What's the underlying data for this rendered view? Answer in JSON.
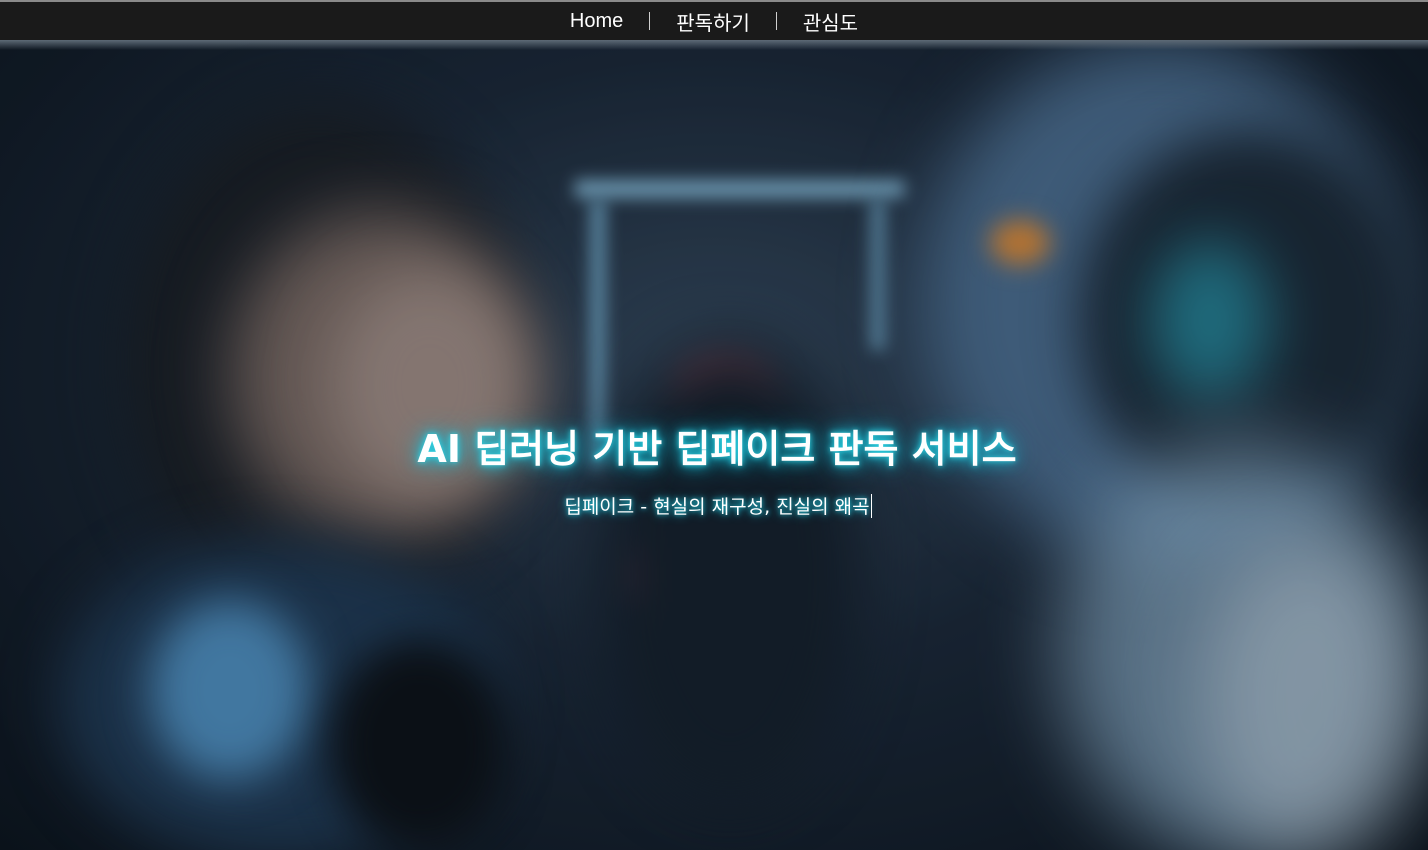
{
  "nav": {
    "items": [
      {
        "label": "Home"
      },
      {
        "label": "판독하기"
      },
      {
        "label": "관심도"
      }
    ]
  },
  "hero": {
    "title": "AI 딥러닝 기반 딥페이크 판독 서비스",
    "subtitle": "딥페이크 - 현실의 재구성, 진실의 왜곡",
    "background_description_colors": {
      "glow": "#19c6df",
      "dark": "#0c141d"
    }
  }
}
